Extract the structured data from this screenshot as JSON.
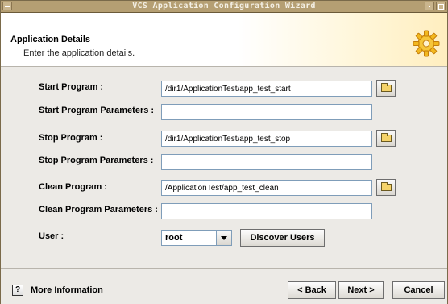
{
  "window": {
    "title": "VCS Application Configuration Wizard"
  },
  "header": {
    "title": "Application Details",
    "subtitle": "Enter the application details.",
    "icon": "gear-icon"
  },
  "form": {
    "start_program": {
      "label": "Start Program :",
      "value": "/dir1/ApplicationTest/app_test_start"
    },
    "start_params": {
      "label": "Start Program Parameters :",
      "value": ""
    },
    "stop_program": {
      "label": "Stop Program :",
      "value": "/dir1/ApplicationTest/app_test_stop"
    },
    "stop_params": {
      "label": "Stop Program Parameters :",
      "value": ""
    },
    "clean_program": {
      "label": "Clean Program :",
      "value": "/ApplicationTest/app_test_clean"
    },
    "clean_params": {
      "label": "Clean Program Parameters :",
      "value": ""
    },
    "user": {
      "label": "User :",
      "value": "root",
      "discover_label": "Discover Users"
    }
  },
  "footer": {
    "more_info": "More Information",
    "back": "< Back",
    "next": "Next >",
    "cancel": "Cancel",
    "help_glyph": "?"
  }
}
